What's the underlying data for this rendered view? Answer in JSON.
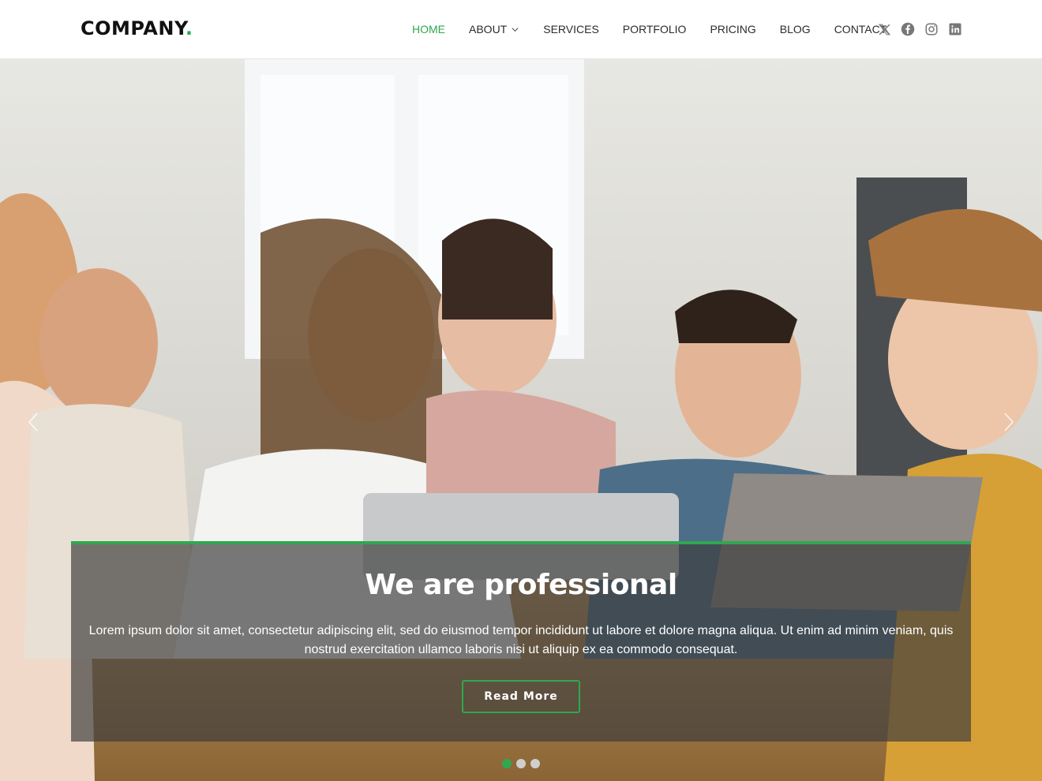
{
  "brand": {
    "name": "COMPANY",
    "dot": ".",
    "accent_color": "#2fa84f"
  },
  "nav": {
    "items": [
      {
        "label": "HOME",
        "active": true
      },
      {
        "label": "ABOUT",
        "has_dropdown": true
      },
      {
        "label": "SERVICES"
      },
      {
        "label": "PORTFOLIO"
      },
      {
        "label": "PRICING"
      },
      {
        "label": "BLOG"
      },
      {
        "label": "CONTACT"
      }
    ]
  },
  "social": [
    "x-icon",
    "facebook-icon",
    "instagram-icon",
    "linkedin-icon"
  ],
  "hero": {
    "title": "We are professional",
    "text": "Lorem ipsum dolor sit amet, consectetur adipiscing elit, sed do eiusmod tempor incididunt ut labore et dolore magna aliqua. Ut enim ad minim veniam, quis nostrud exercitation ullamco laboris nisi ut aliquip ex ea commodo consequat.",
    "button_label": "Read More",
    "slides_count": 3,
    "active_slide": 1
  }
}
